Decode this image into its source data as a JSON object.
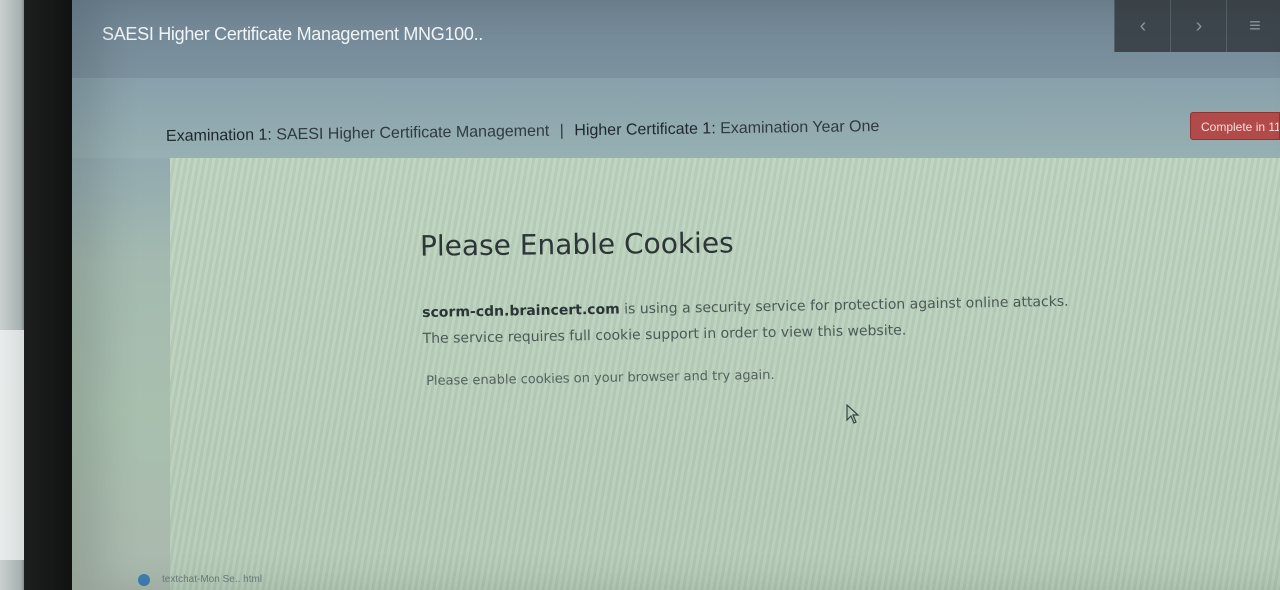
{
  "app": {
    "title": "SAESI Higher Certificate Management MNG100.."
  },
  "breadcrumb": {
    "part1_label": "Examination 1:",
    "part1_value": "SAESI Higher Certificate Management",
    "separator": "|",
    "part2_label": "Higher Certificate 1:",
    "part2_value": "Examination Year One"
  },
  "actions": {
    "complete_label": "Complete in 11"
  },
  "nav": {
    "prev_icon": "chevron-left-icon",
    "next_icon": "chevron-right-icon",
    "menu_icon": "menu-icon"
  },
  "notice": {
    "heading": "Please Enable Cookies",
    "domain": "scorm-cdn.braincert.com",
    "text": "is using a security service for protection against online attacks. The service requires full cookie support in order to view this website.",
    "instruction": "Please enable cookies on your browser and try again."
  },
  "taskbar": {
    "item_label": "textchat-Mon Se.. html"
  },
  "colors": {
    "topbar": "#6f8493",
    "complete_button": "#b24a4a",
    "content_bg": "#bcd0bd"
  }
}
